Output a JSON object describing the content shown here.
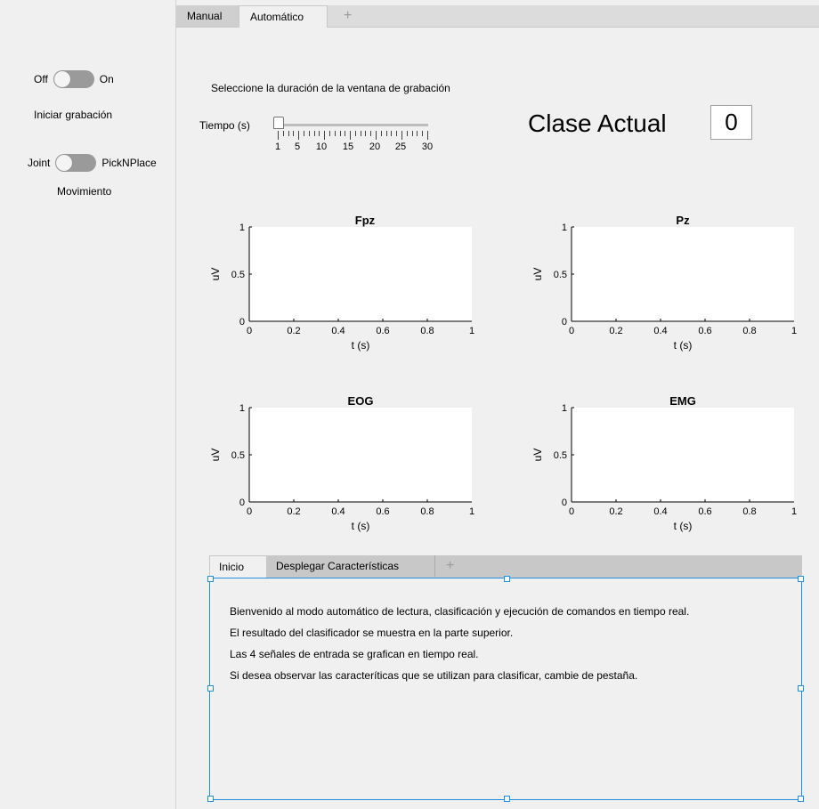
{
  "left_panel": {
    "record_toggle": {
      "off_label": "Off",
      "on_label": "On",
      "caption": "Iniciar grabación"
    },
    "movement_toggle": {
      "off_label": "Joint",
      "on_label": "PickNPlace",
      "caption": "Movimiento"
    }
  },
  "main_tabs": [
    {
      "label": "Manual",
      "active": false
    },
    {
      "label": "Automático",
      "active": true
    },
    {
      "label": "+",
      "active": false
    }
  ],
  "window_selection": {
    "title": "Seleccione la duración de la ventana de grabación",
    "slider_label": "Tiempo (s)",
    "slider_ticks": [
      "1",
      "5",
      "10",
      "15",
      "20",
      "25",
      "30"
    ],
    "slider_value": 1
  },
  "clase_actual": {
    "label": "Clase Actual",
    "value": "0"
  },
  "plots": [
    {
      "title": "Fpz",
      "xlabel": "t (s)",
      "ylabel": "uV",
      "xticks": [
        "0",
        "0.2",
        "0.4",
        "0.6",
        "0.8",
        "1"
      ],
      "yticks": [
        "0",
        "0.5",
        "1"
      ]
    },
    {
      "title": "Pz",
      "xlabel": "t (s)",
      "ylabel": "uV",
      "xticks": [
        "0",
        "0.2",
        "0.4",
        "0.6",
        "0.8",
        "1"
      ],
      "yticks": [
        "0",
        "0.5",
        "1"
      ]
    },
    {
      "title": "EOG",
      "xlabel": "t (s)",
      "ylabel": "uV",
      "xticks": [
        "0",
        "0.2",
        "0.4",
        "0.6",
        "0.8",
        "1"
      ],
      "yticks": [
        "0",
        "0.5",
        "1"
      ]
    },
    {
      "title": "EMG",
      "xlabel": "t (s)",
      "ylabel": "uV",
      "xticks": [
        "0",
        "0.2",
        "0.4",
        "0.6",
        "0.8",
        "1"
      ],
      "yticks": [
        "0",
        "0.5",
        "1"
      ]
    }
  ],
  "lower_tabs": [
    {
      "label": "Inicio",
      "active": true
    },
    {
      "label": "Desplegar Características",
      "active": false
    },
    {
      "label": "+",
      "active": false
    }
  ],
  "lower_content": [
    "Bienvenido al modo automático de lectura, clasificación y ejecución de comandos en tiempo real.",
    "El resultado del clasificador se muestra en la parte superior.",
    "Las 4 señales de entrada se grafican en tiempo real.",
    "Si desea observar las caracteríticas que se utilizan para clasificar, cambie de pestaña."
  ]
}
